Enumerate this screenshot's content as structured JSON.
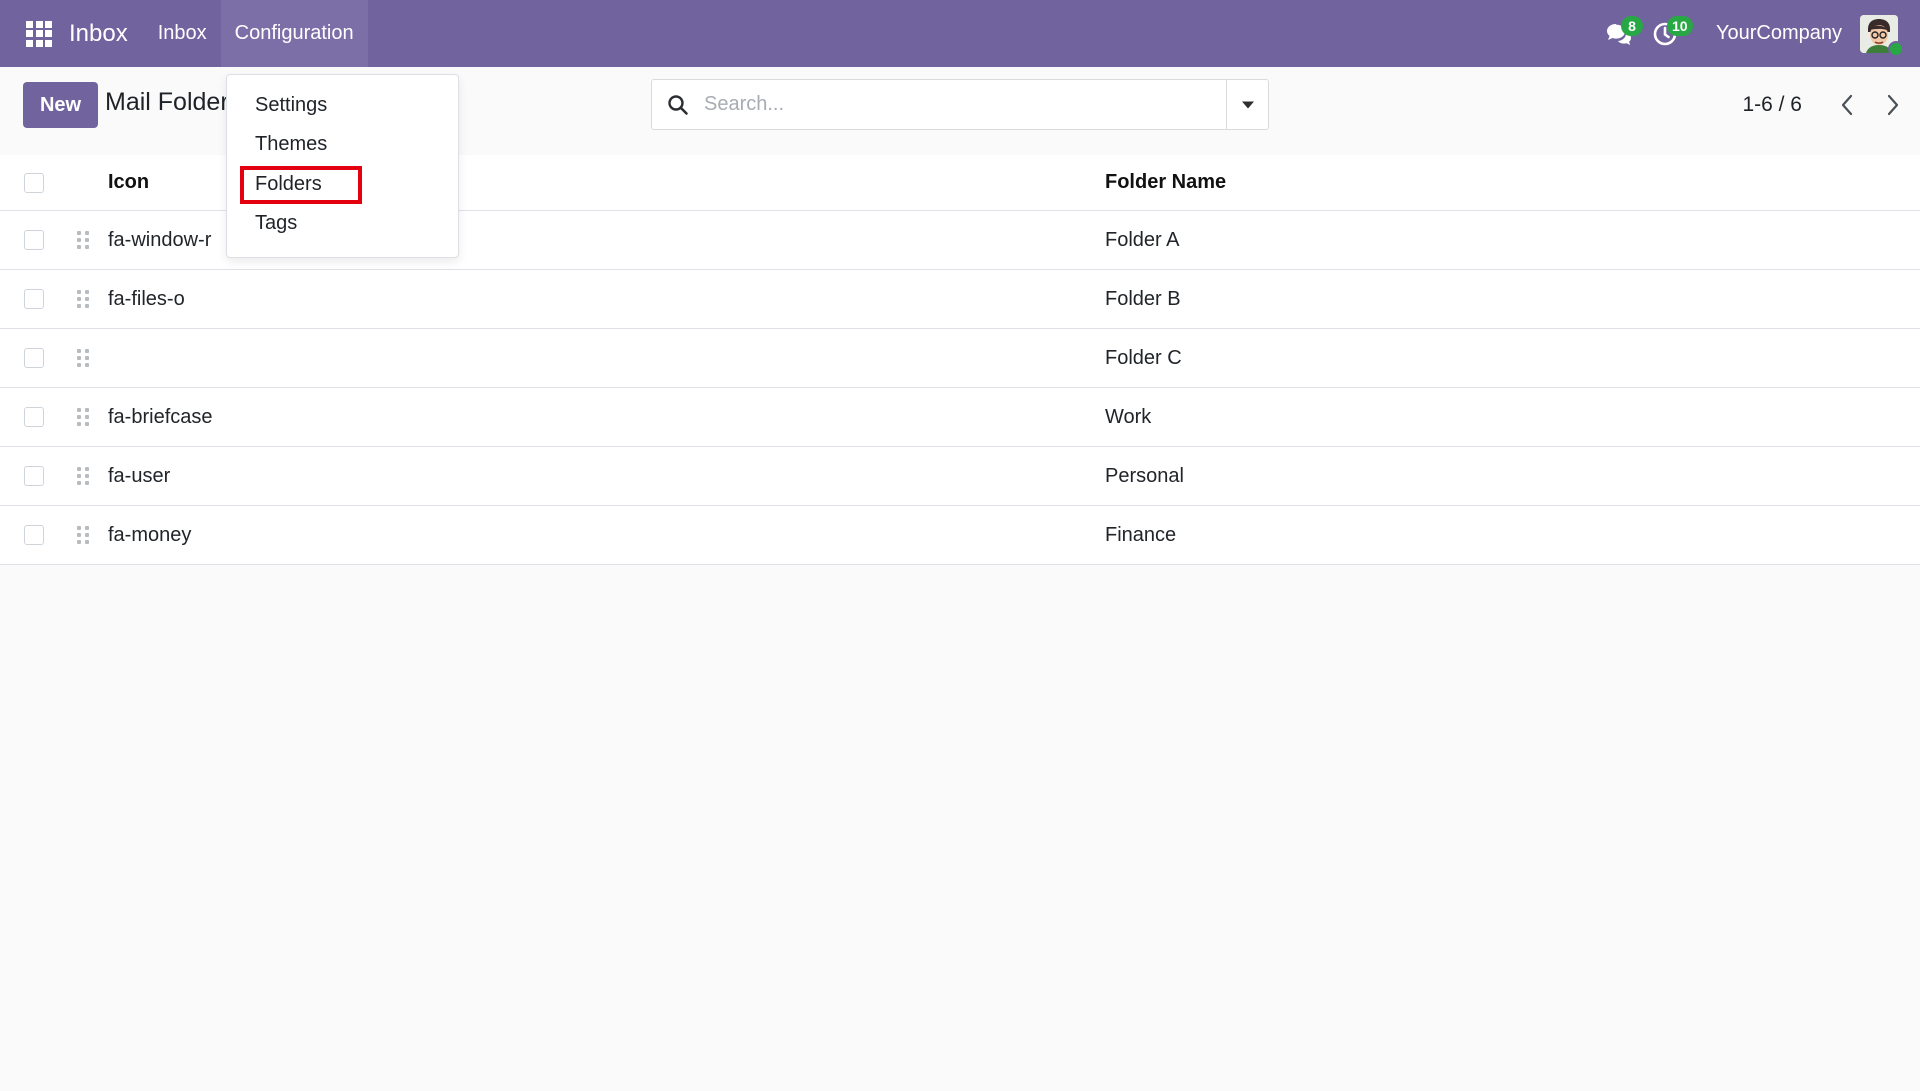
{
  "navbar": {
    "brand": "Inbox",
    "menu": [
      {
        "label": "Inbox"
      },
      {
        "label": "Configuration"
      }
    ],
    "messages_badge": "8",
    "activities_badge": "10",
    "company": "YourCompany"
  },
  "control_panel": {
    "new_label": "New",
    "title": "Mail Folder",
    "search_placeholder": "Search...",
    "pager": "1-6 / 6"
  },
  "config_menu": {
    "items": [
      {
        "label": "Settings"
      },
      {
        "label": "Themes"
      },
      {
        "label": "Folders"
      },
      {
        "label": "Tags"
      }
    ]
  },
  "table": {
    "columns": [
      "Icon",
      "Folder Name"
    ],
    "rows": [
      {
        "icon": "fa-window-r",
        "name": "Folder A"
      },
      {
        "icon": "fa-files-o",
        "name": "Folder B"
      },
      {
        "icon": "",
        "name": "Folder C"
      },
      {
        "icon": "fa-briefcase",
        "name": "Work"
      },
      {
        "icon": "fa-user",
        "name": "Personal"
      },
      {
        "icon": "fa-money",
        "name": "Finance"
      }
    ]
  },
  "colors": {
    "navbar": "#71639e",
    "badge": "#28a745",
    "highlight": "#e3000f"
  }
}
